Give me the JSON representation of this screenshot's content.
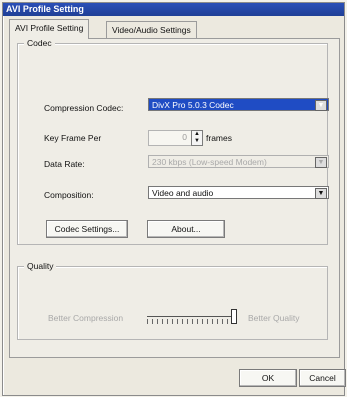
{
  "window": {
    "title": "AVI Profile Setting"
  },
  "tabs": [
    {
      "label": "AVI Profile Setting"
    },
    {
      "label": "Video/Audio Settings"
    }
  ],
  "codec": {
    "group_label": "Codec",
    "compression_codec_label": "Compression Codec:",
    "compression_codec_value": "DivX Pro 5.0.3 Codec",
    "key_frame_label": "Key Frame Per",
    "key_frame_value": "0",
    "frames_label": "frames",
    "data_rate_label": "Data Rate:",
    "data_rate_value": "230 kbps (Low-speed Modem)",
    "composition_label": "Composition:",
    "composition_value": "Video and audio",
    "codec_settings_button": "Codec Settings...",
    "about_button": "About..."
  },
  "quality": {
    "group_label": "Quality",
    "left_label": "Better Compression",
    "right_label": "Better Quality",
    "level_fraction": 0.95
  },
  "footer": {
    "ok_button": "OK",
    "cancel_button": "Cancel"
  },
  "icons": {
    "dropdown": "chevron-down-icon",
    "spin": "spin-arrows-icon"
  },
  "colors": {
    "title_bar": "#1f3f96",
    "selected_field": "#1f4cc4"
  }
}
